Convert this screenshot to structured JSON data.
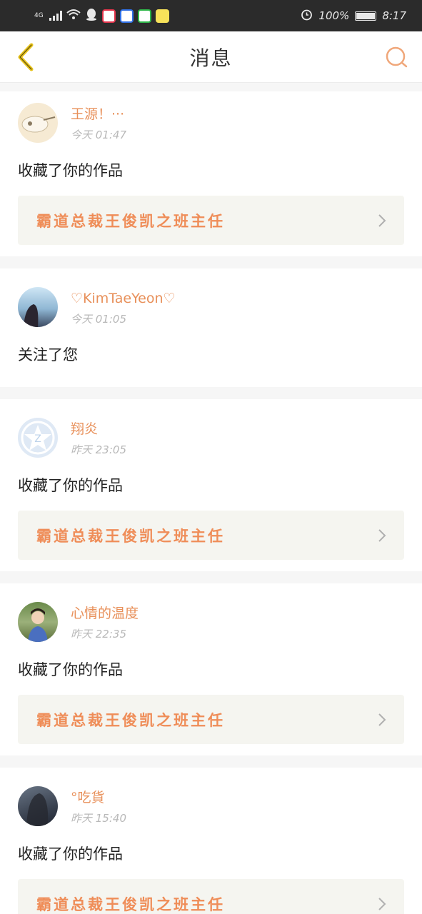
{
  "status": {
    "net": "4G",
    "battery": "100%",
    "time": "8:17"
  },
  "nav": {
    "title": "消息"
  },
  "messages": [
    {
      "name": "王源！···",
      "time": "今天 01:47",
      "action": "收藏了你的作品",
      "work": "霸道总裁王俊凯之班主任"
    },
    {
      "name": "♡KimTaeYeon♡",
      "time": "今天 01:05",
      "action": "关注了您"
    },
    {
      "name": "翔炎",
      "time": "昨天 23:05",
      "action": "收藏了你的作品",
      "work": "霸道总裁王俊凯之班主任"
    },
    {
      "name": "心情的温度",
      "time": "昨天 22:35",
      "action": "收藏了你的作品",
      "work": "霸道总裁王俊凯之班主任"
    },
    {
      "name": "°吃貨",
      "time": "昨天 15:40",
      "action": "收藏了你的作品",
      "work": "霸道总裁王俊凯之班主任"
    }
  ],
  "colors": {
    "accent": "#ef8d58",
    "back_icon": "#e6c21a",
    "card_bg": "#f5f5f0"
  }
}
